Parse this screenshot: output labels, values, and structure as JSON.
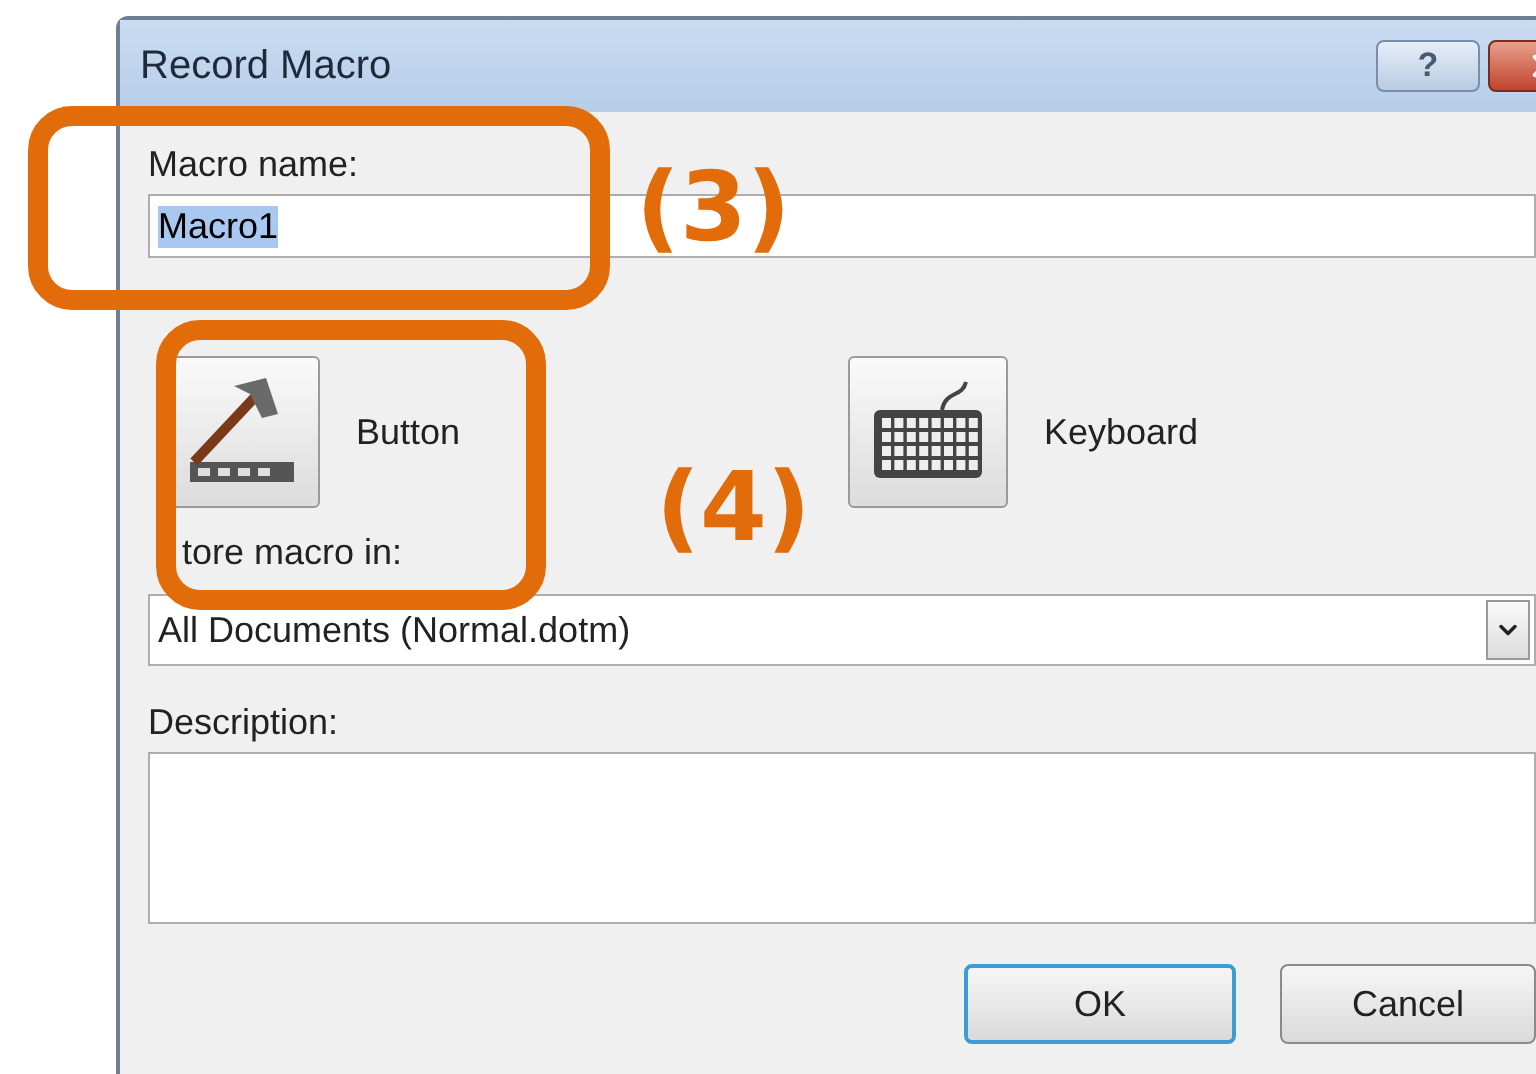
{
  "window": {
    "title": "Record Macro",
    "help_button": "?"
  },
  "macro_name": {
    "label": "Macro name:",
    "value": "Macro1",
    "selected": true
  },
  "assign_options": [
    {
      "kind": "button",
      "label": "Button"
    },
    {
      "kind": "keyboard",
      "label": "Keyboard"
    }
  ],
  "store_macro_in": {
    "label": "tore macro in:",
    "value": "All Documents (Normal.dotm)"
  },
  "description": {
    "label": "Description:"
  },
  "buttons": [
    {
      "label": "OK",
      "default": true
    },
    {
      "label": "Cancel",
      "default": false
    }
  ],
  "callouts": [
    {
      "number": "(3)"
    },
    {
      "number": "(4)"
    }
  ]
}
